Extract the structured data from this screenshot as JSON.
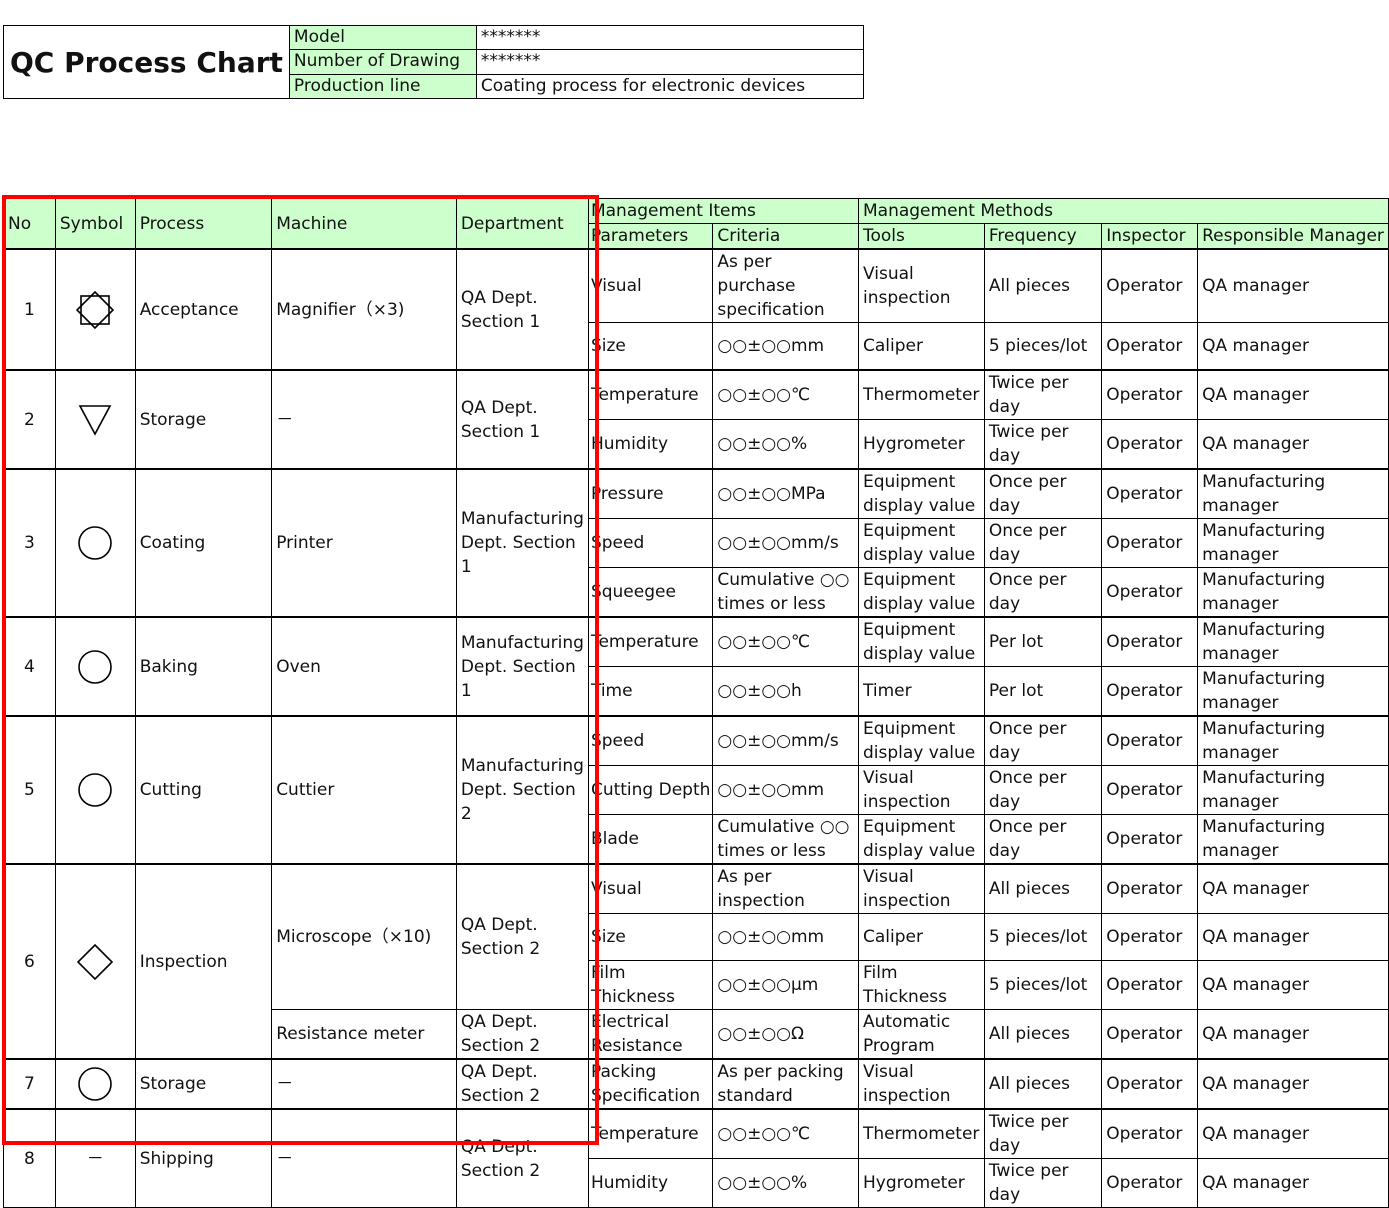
{
  "header": {
    "title": "QC Process Chart",
    "model_label": "Model",
    "model_value": "*******",
    "drawing_label": "Number of Drawing",
    "drawing_value": "*******",
    "line_label": "Production line",
    "line_value": "Coating process for electronic devices"
  },
  "columns": {
    "no": "No",
    "symbol": "Symbol",
    "process": "Process",
    "machine": "Machine",
    "department": "Department",
    "management_items": "Management Items",
    "management_methods": "Management Methods",
    "parameters": "Parameters",
    "criteria": "Criteria",
    "tools": "Tools",
    "frequency": "Frequency",
    "inspector": "Inspector",
    "responsible_manager": "Responsible Manager"
  },
  "processes": [
    {
      "no": "1",
      "symbol": "diamond-in-square-icon",
      "process": "Acceptance",
      "machine": "Magnifier（×3)",
      "department": "QA Dept. Section 1"
    },
    {
      "no": "2",
      "symbol": "triangle-down-icon",
      "process": "Storage",
      "machine": "－",
      "department": "QA Dept. Section 1"
    },
    {
      "no": "3",
      "symbol": "circle-icon",
      "process": "Coating",
      "machine": "Printer",
      "department": "Manufacturing Dept. Section 1"
    },
    {
      "no": "4",
      "symbol": "circle-icon",
      "process": "Baking",
      "machine": "Oven",
      "department": "Manufacturing Dept. Section 1"
    },
    {
      "no": "5",
      "symbol": "circle-icon",
      "process": "Cutting",
      "machine": "Cuttier",
      "department": "Manufacturing Dept. Section 2"
    },
    {
      "no": "6",
      "symbol": "diamond-icon",
      "process": "Inspection",
      "machine": "Microscope（×10)",
      "department": "QA Dept. Section 2",
      "machine_2": "Resistance meter",
      "department_2": "QA Dept. Section 2"
    },
    {
      "no": "7",
      "symbol": "circle-icon",
      "process": "Storage",
      "machine": "－",
      "department": "QA Dept. Section 2"
    },
    {
      "no": "8",
      "symbol": "dash",
      "process": "Shipping",
      "machine": "－",
      "department": "QA Dept. Section 2",
      "symbol_text": "－"
    }
  ],
  "rows": [
    {
      "parameter": "Visual",
      "criteria": "As per purchase specification",
      "tool": "Visual inspection",
      "frequency": "All pieces",
      "inspector": "Operator",
      "manager": "QA manager"
    },
    {
      "parameter": "Size",
      "criteria": "○○±○○mm",
      "tool": "Caliper",
      "frequency": "5 pieces/lot",
      "inspector": "Operator",
      "manager": "QA manager"
    },
    {
      "parameter": "Temperature",
      "criteria": "○○±○○℃",
      "tool": "Thermometer",
      "frequency": "Twice per day",
      "inspector": "Operator",
      "manager": "QA manager"
    },
    {
      "parameter": "Humidity",
      "criteria": "○○±○○%",
      "tool": "Hygrometer",
      "frequency": "Twice per day",
      "inspector": "Operator",
      "manager": "QA manager"
    },
    {
      "parameter": "Pressure",
      "criteria": "○○±○○MPa",
      "tool": "Equipment display value",
      "frequency": "Once per day",
      "inspector": "Operator",
      "manager": "Manufacturing manager"
    },
    {
      "parameter": "Speed",
      "criteria": "○○±○○mm/s",
      "tool": "Equipment display value",
      "frequency": "Once per day",
      "inspector": "Operator",
      "manager": "Manufacturing manager"
    },
    {
      "parameter": "Squeegee",
      "criteria": "Cumulative ○○ times or less",
      "tool": "Equipment display value",
      "frequency": "Once per day",
      "inspector": "Operator",
      "manager": "Manufacturing manager"
    },
    {
      "parameter": "Temperature",
      "criteria": "○○±○○℃",
      "tool": "Equipment display value",
      "frequency": "Per lot",
      "inspector": "Operator",
      "manager": "Manufacturing manager"
    },
    {
      "parameter": "Time",
      "criteria": "○○±○○h",
      "tool": "Timer",
      "frequency": "Per lot",
      "inspector": "Operator",
      "manager": "Manufacturing manager"
    },
    {
      "parameter": "Speed",
      "criteria": "○○±○○mm/s",
      "tool": "Equipment display value",
      "frequency": "Once per day",
      "inspector": "Operator",
      "manager": "Manufacturing manager"
    },
    {
      "parameter": "Cutting Depth",
      "criteria": "○○±○○mm",
      "tool": "Visual inspection",
      "frequency": "Once per day",
      "inspector": "Operator",
      "manager": "Manufacturing manager"
    },
    {
      "parameter": "Blade",
      "criteria": "Cumulative ○○ times or less",
      "tool": "Equipment display value",
      "frequency": "Once per day",
      "inspector": "Operator",
      "manager": "Manufacturing manager"
    },
    {
      "parameter": "Visual",
      "criteria": "As per inspection",
      "tool": "Visual inspection",
      "frequency": "All pieces",
      "inspector": "Operator",
      "manager": "QA manager"
    },
    {
      "parameter": "Size",
      "criteria": "○○±○○mm",
      "tool": "Caliper",
      "frequency": "5 pieces/lot",
      "inspector": "Operator",
      "manager": "QA manager"
    },
    {
      "parameter": "Film Thickness",
      "criteria": "○○±○○μm",
      "tool": "Film Thickness",
      "frequency": "5 pieces/lot",
      "inspector": "Operator",
      "manager": "QA manager"
    },
    {
      "parameter": "Electrical Resistance",
      "criteria": "○○±○○Ω",
      "tool": "Automatic Program",
      "frequency": "All pieces",
      "inspector": "Operator",
      "manager": "QA manager"
    },
    {
      "parameter": "Packing Specification",
      "criteria": "As per packing standard",
      "tool": "Visual inspection",
      "frequency": "All pieces",
      "inspector": "Operator",
      "manager": "QA manager"
    },
    {
      "parameter": "Temperature",
      "criteria": "○○±○○℃",
      "tool": "Thermometer",
      "frequency": "Twice per day",
      "inspector": "Operator",
      "manager": "QA manager"
    },
    {
      "parameter": "Humidity",
      "criteria": "○○±○○%",
      "tool": "Hygrometer",
      "frequency": "Twice per day",
      "inspector": "Operator",
      "manager": "QA manager"
    }
  ],
  "colors": {
    "header_green": "#ccffcc",
    "highlight_red": "#ff0000"
  }
}
